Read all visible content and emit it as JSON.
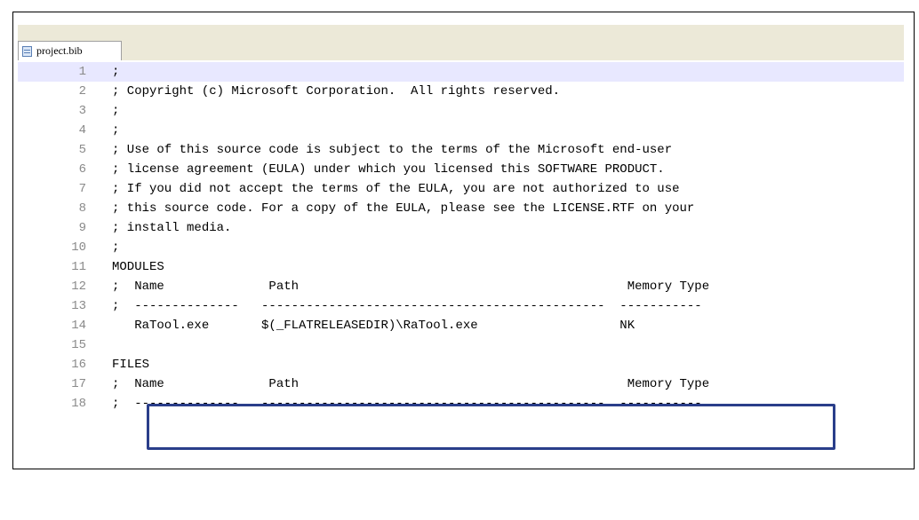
{
  "tab": {
    "label": "project.bib"
  },
  "lines": [
    {
      "n": "1",
      "text": ";"
    },
    {
      "n": "2",
      "text": "; Copyright (c) Microsoft Corporation.  All rights reserved."
    },
    {
      "n": "3",
      "text": ";"
    },
    {
      "n": "4",
      "text": ";"
    },
    {
      "n": "5",
      "text": "; Use of this source code is subject to the terms of the Microsoft end-user"
    },
    {
      "n": "6",
      "text": "; license agreement (EULA) under which you licensed this SOFTWARE PRODUCT."
    },
    {
      "n": "7",
      "text": "; If you did not accept the terms of the EULA, you are not authorized to use"
    },
    {
      "n": "8",
      "text": "; this source code. For a copy of the EULA, please see the LICENSE.RTF on your"
    },
    {
      "n": "9",
      "text": "; install media."
    },
    {
      "n": "10",
      "text": ";"
    },
    {
      "n": "11",
      "text": "MODULES"
    },
    {
      "n": "12",
      "text": ";  Name              Path                                            Memory Type"
    },
    {
      "n": "13",
      "text": ";  --------------   ----------------------------------------------  -----------"
    },
    {
      "n": "14",
      "text": "   RaTool.exe       $(_FLATRELEASEDIR)\\RaTool.exe                   NK"
    },
    {
      "n": "15",
      "text": ""
    },
    {
      "n": "16",
      "text": "FILES"
    },
    {
      "n": "17",
      "text": ";  Name              Path                                            Memory Type"
    },
    {
      "n": "18",
      "text": ";  --------------   ----------------------------------------------  -----------"
    }
  ]
}
